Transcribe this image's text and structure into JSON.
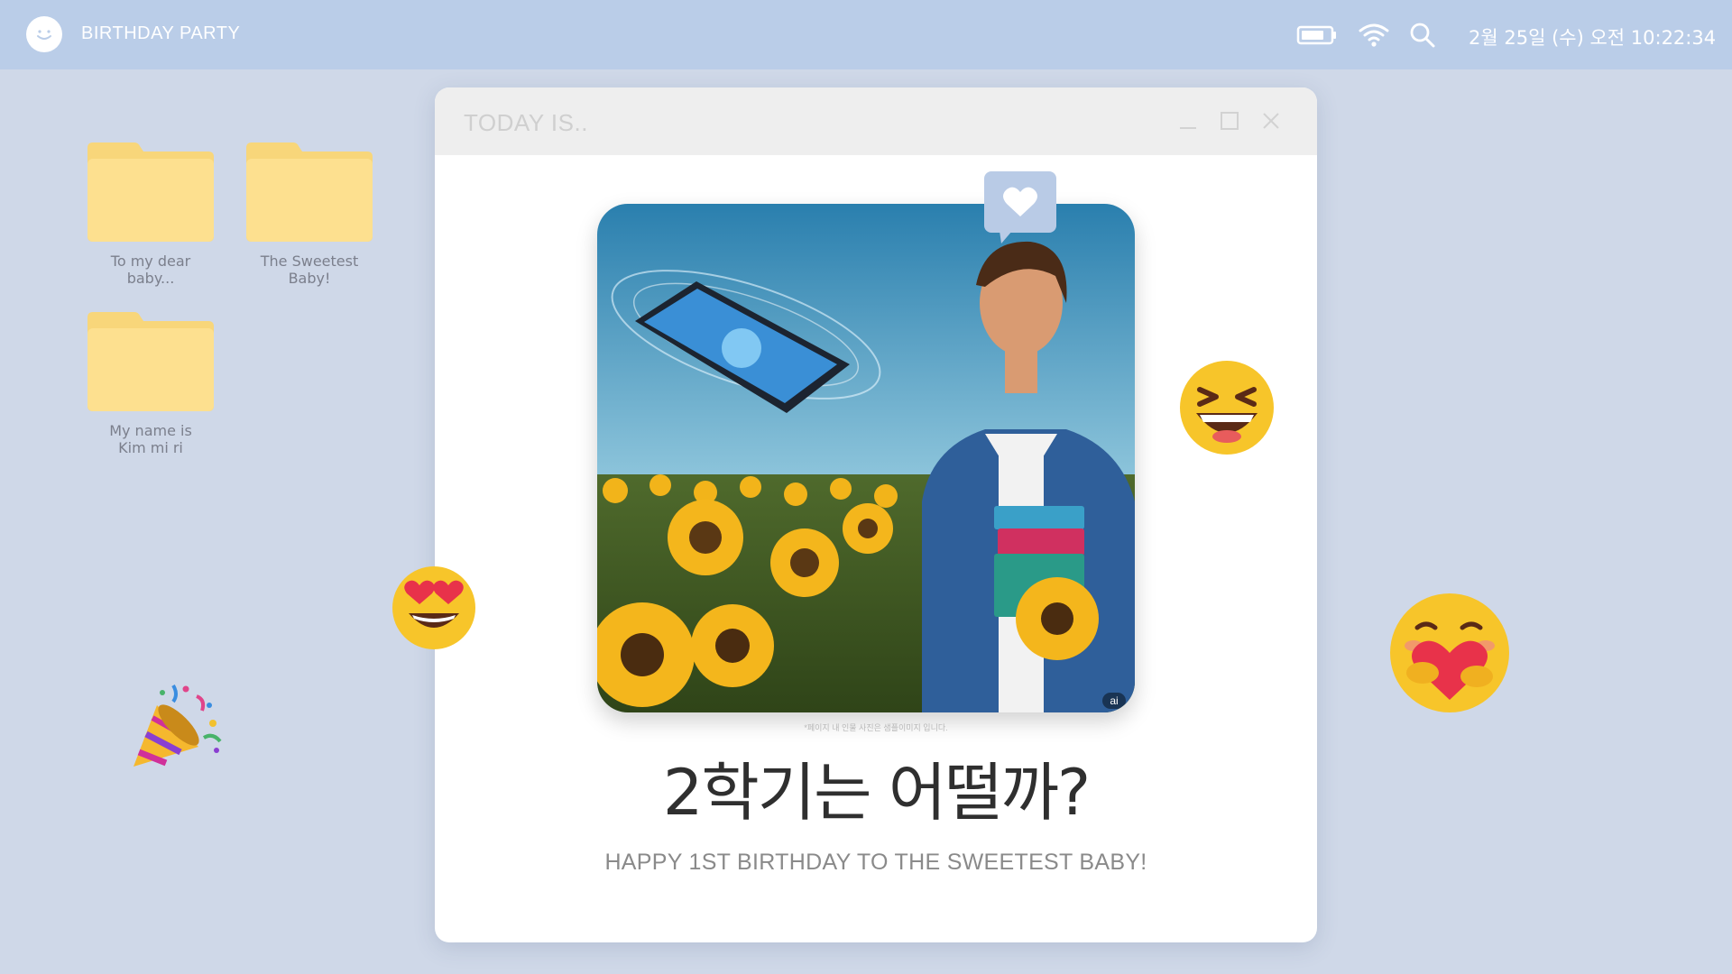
{
  "topbar": {
    "app_title": "BIRTHDAY PARTY",
    "logo_icon": "smiley-face-icon",
    "battery_icon": "battery-icon",
    "wifi_icon": "wifi-icon",
    "search_icon": "search-icon",
    "datetime": "2월 25일 (수) 오전 10:22:34"
  },
  "desktop": {
    "icons": [
      {
        "line1": "To my dear",
        "line2": "baby..."
      },
      {
        "line1": "The Sweetest",
        "line2": "Baby!"
      },
      {
        "line1": "My name is",
        "line2": "Kim mi ri"
      }
    ]
  },
  "window": {
    "title": "TODAY IS..",
    "controls": [
      "minimize-icon",
      "maximize-icon",
      "close-icon"
    ],
    "photo_badge": "ai",
    "disclaimer": "*페이지 내 인물 사진은 샘플이미지 입니다.",
    "headline": "2학기는 어떨까?",
    "subline": "HAPPY 1ST BIRTHDAY TO THE SWEETEST BABY!"
  },
  "decorations": [
    "heart-speech-bubble-icon",
    "heart-eyes-emoji",
    "laughing-emoji",
    "hugging-heart-emoji",
    "party-popper-emoji"
  ],
  "colors": {
    "background": "#cfd8e8",
    "topbar": "#bacde8",
    "folder": "#fde08f",
    "window_titlebar": "#eeeeee",
    "bubble": "#b9cbe6"
  }
}
